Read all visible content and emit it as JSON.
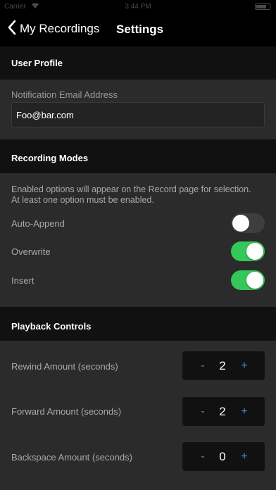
{
  "status_bar": {
    "carrier": "Carrier",
    "time": "3:44 PM"
  },
  "navbar": {
    "back_label": "My Recordings",
    "title": "Settings"
  },
  "user_profile": {
    "header": "User Profile",
    "email_label": "Notification Email Address",
    "email_value": "Foo@bar.com"
  },
  "recording_modes": {
    "header": "Recording Modes",
    "description_line1": "Enabled options will appear on the Record page for selection.",
    "description_line2": "At least one option must be enabled.",
    "options": [
      {
        "label": "Auto-Append",
        "enabled": false
      },
      {
        "label": "Overwrite",
        "enabled": true
      },
      {
        "label": "Insert",
        "enabled": true
      }
    ]
  },
  "playback_controls": {
    "header": "Playback Controls",
    "steppers": [
      {
        "label": "Rewind Amount (seconds)",
        "value": "2",
        "minus": "-",
        "plus": "+"
      },
      {
        "label": "Forward Amount (seconds)",
        "value": "2",
        "minus": "-",
        "plus": "+"
      },
      {
        "label": "Backspace Amount (seconds)",
        "value": "0",
        "minus": "-",
        "plus": "+"
      }
    ]
  },
  "colors": {
    "toggle_on": "#34c759",
    "stepper_accent": "#4a90e2"
  }
}
